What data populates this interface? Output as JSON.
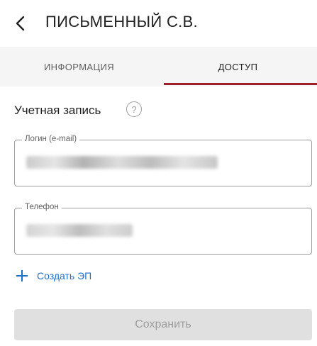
{
  "header": {
    "title": "ПИСЬМЕННЫЙ С.В.",
    "back_icon": "chevron-left-icon"
  },
  "tabs": [
    {
      "label": "ИНФОРМАЦИЯ",
      "active": false
    },
    {
      "label": "ДОСТУП",
      "active": true
    }
  ],
  "colors": {
    "accent": "#9e1e2b",
    "link": "#1e6fc8",
    "disabled_button": "#e0e0e0"
  },
  "account": {
    "section_title": "Учетная запись",
    "help_symbol": "?",
    "login_field": {
      "label": "Логин (e-mail)"
    },
    "phone_field": {
      "label": "Телефон"
    }
  },
  "actions": {
    "create_signature_label": "Создать ЭП",
    "save_label": "Сохранить",
    "save_enabled": false
  }
}
